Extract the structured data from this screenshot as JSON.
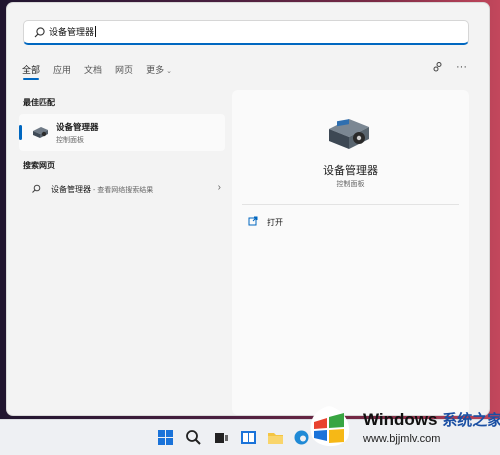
{
  "search": {
    "value": "设备管理器"
  },
  "tabs": [
    {
      "label": "全部"
    },
    {
      "label": "应用"
    },
    {
      "label": "文档"
    },
    {
      "label": "网页"
    },
    {
      "label": "更多"
    }
  ],
  "sections": {
    "best_match": "最佳匹配",
    "web_search": "搜索网页"
  },
  "best_match": {
    "title": "设备管理器",
    "subtitle": "控制面板"
  },
  "web_result": {
    "title": "设备管理器",
    "description": " - 查看网络搜索结果"
  },
  "detail": {
    "title": "设备管理器",
    "category": "控制面板",
    "actions": [
      {
        "label": "打开"
      }
    ]
  },
  "colors": {
    "accent": "#0067c0",
    "panel": "#f3f3f3"
  },
  "taskbar": {
    "icons": [
      "start-icon",
      "search-icon",
      "task-view-icon",
      "widgets-icon",
      "file-explorer-icon",
      "edge-icon"
    ]
  },
  "watermark": {
    "brand": "Windows",
    "brand_cn": "系统之家",
    "url": "www.bjjmlv.com"
  }
}
